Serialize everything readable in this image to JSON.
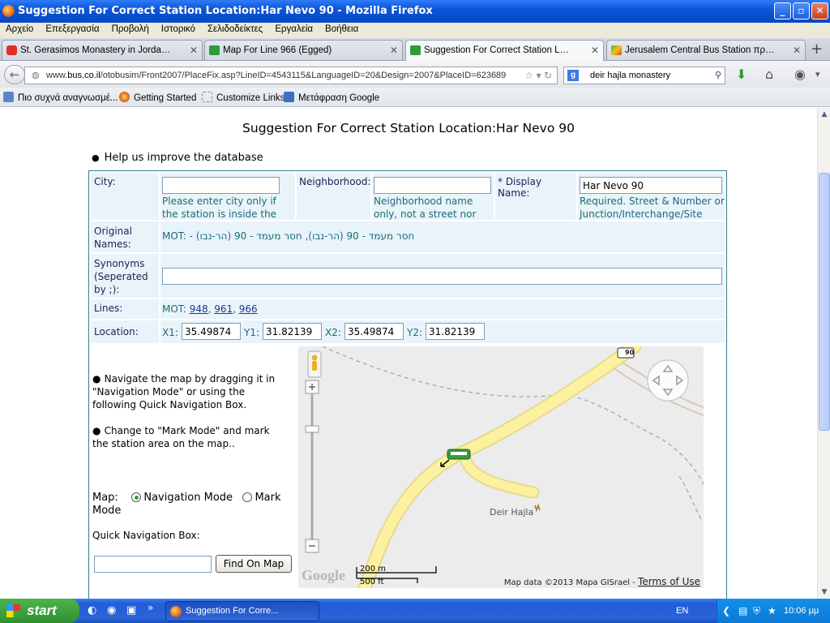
{
  "window": {
    "title": "Suggestion For Correct Station Location:Har Nevo 90 - Mozilla Firefox",
    "min": "_",
    "max": "▫",
    "close": "✕"
  },
  "menu": [
    "Αρχείο",
    "Επεξεργασία",
    "Προβολή",
    "Ιστορικό",
    "Σελιδοδείκτες",
    "Εργαλεία",
    "Βοήθεια"
  ],
  "tabs": [
    {
      "label": "St. Gerasimos Monastery in Jordan Valle..."
    },
    {
      "label": "Map For Line 966 (Egged)"
    },
    {
      "label": "Suggestion For Correct Station Location:..."
    },
    {
      "label": "Jerusalem Central Bus Station προς Deir ..."
    }
  ],
  "nav": {
    "url_prefix": "www.",
    "url_site": "bus.co.il",
    "url_rest": "/otobusim/Front2007/PlaceFix.asp?LineID=4543115&LanguageID=20&Design=2007&PlaceID=623689",
    "search": "deir hajla monastery"
  },
  "bookmarks": [
    "Πιο συχνά αναγνωσμέ...",
    "Getting Started",
    "Customize Links",
    "Μετάφραση Google"
  ],
  "page": {
    "title": "Suggestion For Correct Station Location:Har Nevo 90",
    "help": "Help us improve the database",
    "city_label": "City:",
    "city_value": "",
    "city_hint": "Please enter city only if the station is inside the city",
    "neigh_label": "Neighborhood:",
    "neigh_value": "",
    "neigh_hint": "Neighborhood name only, not a street nor building",
    "display_label": "* Display Name:",
    "display_value": "Har Nevo 90",
    "display_hint": "Required. Street & Number or Junction/Interchange/Site",
    "orig_label": "Original Names:",
    "orig_value": "MOT: - חסר מעמד - 90 (הר-נבו), חסר מעמד - 90 (הר-נבו)",
    "syn_label": "Synonyms (Seperated by ;):",
    "syn_value": "",
    "lines_label": "Lines:",
    "lines_prefix": "MOT:",
    "lines": [
      "948",
      "961",
      "966"
    ],
    "loc_label": "Location:",
    "x1_label": "X1:",
    "x1": "35.49874",
    "y1_label": "Y1:",
    "y1": "31.82139",
    "x2_label": "X2:",
    "x2": "35.49874",
    "y2_label": "Y2:",
    "y2": "31.82139",
    "nav_help": "Navigate the map by dragging it in \"Navigation Mode\" or using the following Quick Navigation Box.",
    "mark_help": "Change to \"Mark Mode\" and mark the station area on the map..",
    "map_label": "Map:",
    "mode_nav": "Navigation Mode",
    "mode_mark": "Mark",
    "mode_suffix": "Mode",
    "quick_label": "Quick Navigation Box:",
    "quick_value": "",
    "find_label": "Find On Map"
  },
  "map": {
    "road_shield": "90",
    "place": "Deir Hajla",
    "scale_m": "200 m",
    "scale_ft": "500 ft",
    "attribution": "Map data ©2013 Mapa GISrael - ",
    "terms": "Terms of Use",
    "google": "Google"
  },
  "taskbar": {
    "start": "start",
    "item": "Suggestion For Corre...",
    "lang": "EN",
    "clock": "10:06 μμ"
  }
}
